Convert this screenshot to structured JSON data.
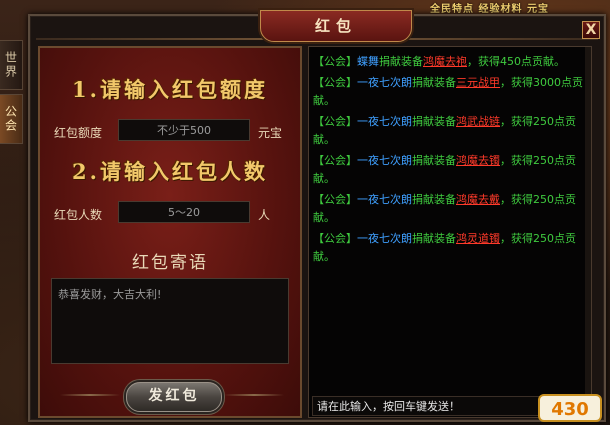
{
  "hud": {
    "text": "全民特点  经验材料  元宝"
  },
  "side_tabs": [
    {
      "label": "世界",
      "active": false
    },
    {
      "label": "公会",
      "active": true
    }
  ],
  "window": {
    "title": "红包",
    "close_label": "X"
  },
  "form": {
    "title_amount": "1.请输入红包额度",
    "amount_label": "红包额度",
    "amount_placeholder": "不少于500",
    "amount_unit": "元宝",
    "title_count": "2.请输入红包人数",
    "count_label": "红包人数",
    "count_placeholder": "5～20",
    "count_unit": "人",
    "message_heading": "红包寄语",
    "message_value": "恭喜发财，大吉大利!",
    "send_label": "发红包"
  },
  "log": [
    {
      "guild": "【公会】",
      "player": "蝶舞",
      "action": "捐献装备",
      "item": "鸿魔去袍",
      "rest": "，获得450点贡献。"
    },
    {
      "guild": "【公会】",
      "player": "一夜七次朗",
      "action": "捐献装备",
      "item": "三元战甲",
      "rest": "，获得3000点贡献。"
    },
    {
      "guild": "【公会】",
      "player": "一夜七次朗",
      "action": "捐献装备",
      "item": "鸿武战链",
      "rest": "，获得250点贡献。"
    },
    {
      "guild": "【公会】",
      "player": "一夜七次朗",
      "action": "捐献装备",
      "item": "鸿魔去镯",
      "rest": "，获得250点贡献。"
    },
    {
      "guild": "【公会】",
      "player": "一夜七次朗",
      "action": "捐献装备",
      "item": "鸿魔去戴",
      "rest": "，获得250点贡献。"
    },
    {
      "guild": "【公会】",
      "player": "一夜七次朗",
      "action": "捐献装备",
      "item": "鸿灵道镯",
      "rest": "，获得250点贡献。"
    }
  ],
  "chat": {
    "placeholder": "请在此输入，按回车键发送！"
  },
  "logo": {
    "text": "430"
  },
  "colors": {
    "guild": "#3fcb3f",
    "player": "#3fa0ff",
    "item": "#ff3a2a",
    "title_gold": "#f2c86a"
  }
}
